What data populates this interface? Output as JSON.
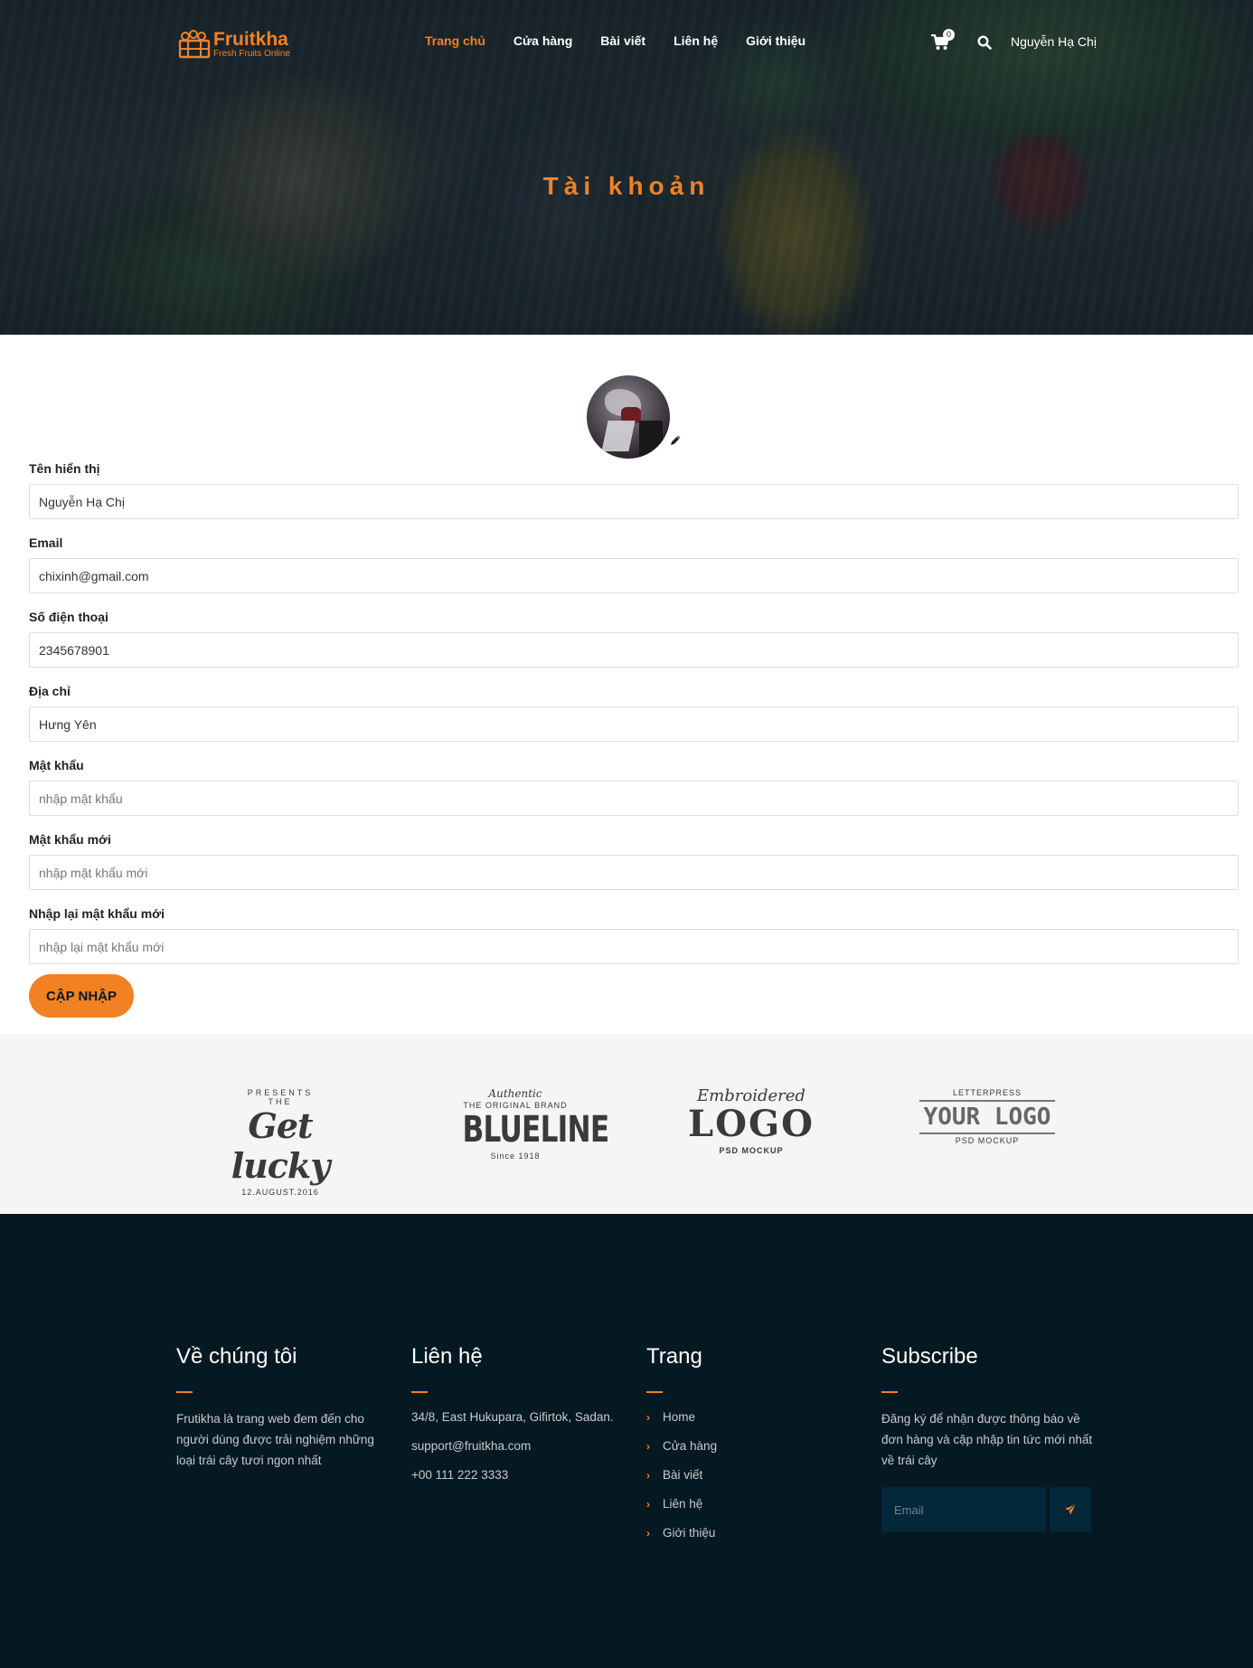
{
  "brand": {
    "name": "Fruitkha",
    "tagline": "Fresh Fruits Online",
    "accent_color": "#F28123",
    "dark_color": "#051922"
  },
  "nav": {
    "items": [
      {
        "label": "Trang chủ",
        "active": true
      },
      {
        "label": "Cửa hàng",
        "active": false
      },
      {
        "label": "Bài viết",
        "active": false
      },
      {
        "label": "Liên hệ",
        "active": false
      },
      {
        "label": "Giới thiệu",
        "active": false
      }
    ],
    "cart_icon": "shopping-cart-icon",
    "cart_count": "0",
    "search_icon": "search-icon",
    "user_name": "Nguyễn Hạ Chị"
  },
  "hero": {
    "title": "Tài khoản"
  },
  "profile": {
    "edit_icon": "pencil-icon",
    "fields": [
      {
        "label": "Tên hiển thị",
        "value": "Nguyễn Hạ Chị",
        "placeholder": ""
      },
      {
        "label": "Email",
        "value": "chixinh@gmail.com",
        "placeholder": ""
      },
      {
        "label": "Số điện thoại",
        "value": "2345678901",
        "placeholder": ""
      },
      {
        "label": "Địa chỉ",
        "value": "Hưng Yên",
        "placeholder": ""
      },
      {
        "label": "Mật khẩu",
        "value": "",
        "placeholder": "nhập mật khẩu"
      },
      {
        "label": "Mật khẩu mới",
        "value": "",
        "placeholder": "nhập mật khẩu mới"
      },
      {
        "label": "Nhập lại mật khẩu mới",
        "value": "",
        "placeholder": "nhập lại mật khẩu mới"
      }
    ],
    "submit_label": "CẬP NHẬP"
  },
  "brands": [
    {
      "top": "PRESENTS",
      "mid": "THE",
      "main": "Get lucky",
      "bottom": "12.AUGUST.2016"
    },
    {
      "top": "Authentic",
      "mid": "THE ORIGINAL BRAND",
      "main": "BLUELINE",
      "bottom": "Since 1918"
    },
    {
      "top": "Embroidered",
      "main": "LOGO",
      "bottom": "PSD MOCKUP"
    },
    {
      "top": "LETTERPRESS",
      "main": "YOUR LOGO",
      "bottom": "PSD MOCKUP"
    }
  ],
  "footer": {
    "about": {
      "title": "Về chúng tôi",
      "text": "Frutikha là trang web đem đến cho người dùng được trải nghiệm những loại trái cây tươi ngon nhất"
    },
    "contact": {
      "title": "Liên hệ",
      "address": "34/8, East Hukupara, Gifirtok, Sadan.",
      "email": "support@fruitkha.com",
      "phone": "+00 111 222 3333"
    },
    "pages": {
      "title": "Trang",
      "links": [
        "Home",
        "Cửa hàng",
        "Bài viết",
        "Liên hệ",
        "Giới thiệu"
      ]
    },
    "subscribe": {
      "title": "Subscribe",
      "text": "Đăng ký để nhận được thông báo về đơn hàng và cập nhập tin tức mới nhất về trái cây",
      "placeholder": "Email",
      "send_icon": "paper-plane-icon"
    }
  }
}
